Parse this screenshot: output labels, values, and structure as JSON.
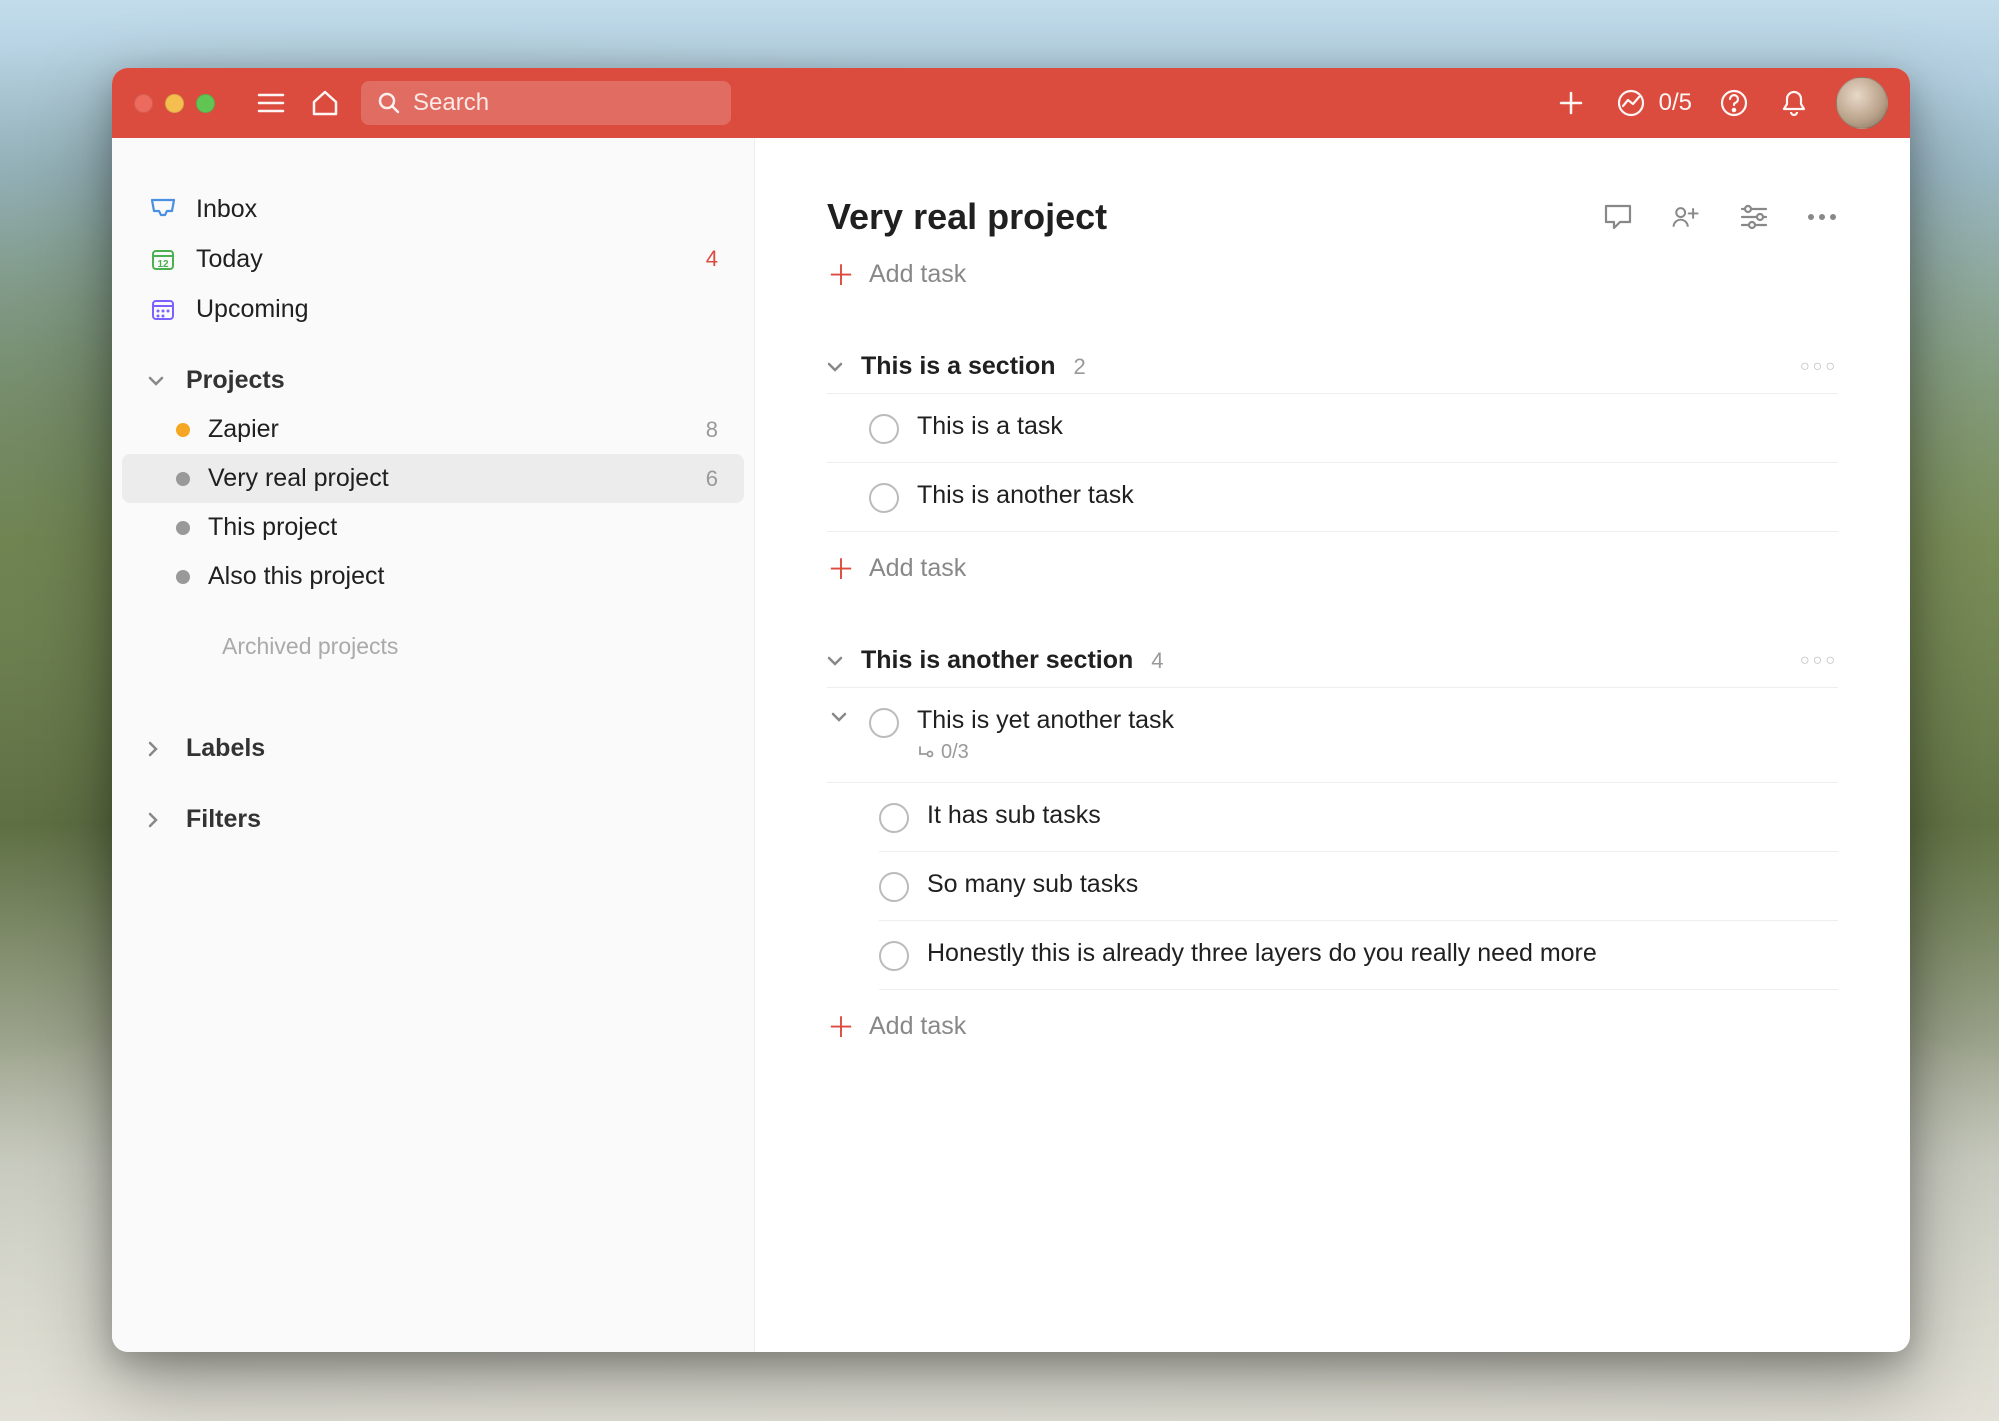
{
  "colors": {
    "accent": "#db4c3f"
  },
  "titlebar": {
    "search_placeholder": "Search",
    "progress": "0/5"
  },
  "sidebar": {
    "nav": [
      {
        "label": "Inbox",
        "count": "",
        "icon": "inbox"
      },
      {
        "label": "Today",
        "count": "4",
        "icon": "today",
        "count_color": "red"
      },
      {
        "label": "Upcoming",
        "count": "",
        "icon": "upcoming"
      }
    ],
    "projects_heading": "Projects",
    "projects": [
      {
        "label": "Zapier",
        "count": "8",
        "color": "orange",
        "active": false
      },
      {
        "label": "Very real project",
        "count": "6",
        "color": "gray",
        "active": true
      },
      {
        "label": "This project",
        "count": "",
        "color": "gray",
        "active": false
      },
      {
        "label": "Also this project",
        "count": "",
        "color": "gray",
        "active": false
      }
    ],
    "archived_label": "Archived projects",
    "labels_heading": "Labels",
    "filters_heading": "Filters"
  },
  "main": {
    "title": "Very real project",
    "add_task_label": "Add task",
    "sections": [
      {
        "title": "This is a section",
        "count": "2",
        "tasks": [
          {
            "title": "This is a task"
          },
          {
            "title": "This is another task"
          }
        ]
      },
      {
        "title": "This is another section",
        "count": "4",
        "tasks": [
          {
            "title": "This is yet another task",
            "expandable": true,
            "subtask_progress": "0/3",
            "subtasks": [
              {
                "title": "It has sub tasks"
              },
              {
                "title": "So many sub tasks"
              },
              {
                "title": "Honestly this is already three layers do you really need more"
              }
            ]
          }
        ]
      }
    ]
  }
}
